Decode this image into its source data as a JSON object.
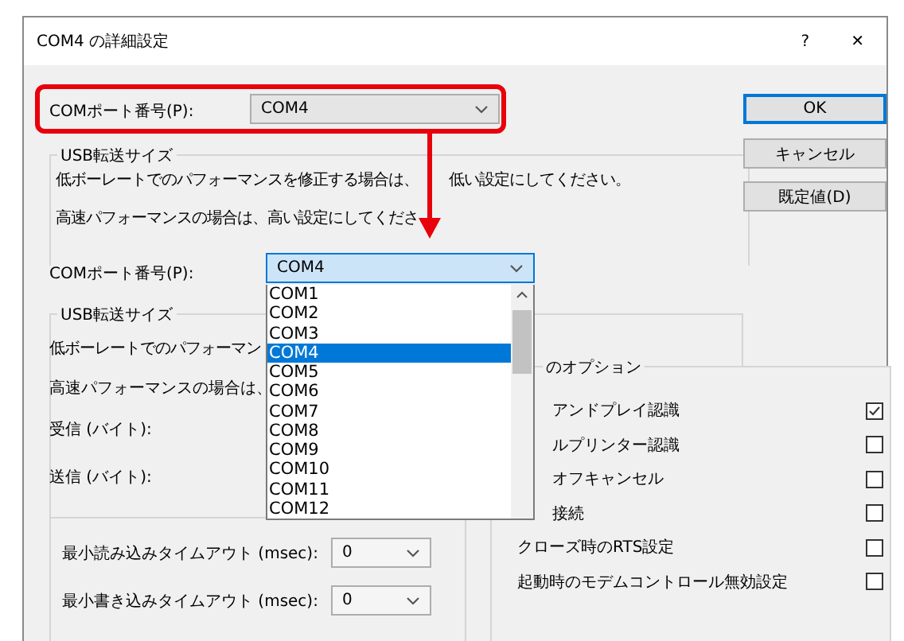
{
  "window": {
    "title": "COM4 の詳細設定",
    "help": "?",
    "close": "✕"
  },
  "top": {
    "port_label": "COMポート番号(P):",
    "port_value": "COM4",
    "group_title": "USB転送サイズ",
    "line_1": "低ボーレートでのパフォーマンスを修正する場合は、",
    "line_1_rest": "低い設定にしてください。",
    "line_2": "高速パフォーマンスの場合は、高い設定にしてくださ"
  },
  "buttons": [
    {
      "label": "OK",
      "default": true
    },
    {
      "label": "キャンセル",
      "default": false
    },
    {
      "label": "既定値(D)",
      "default": false
    }
  ],
  "port": {
    "label": "COMポート番号(P):",
    "value": "COM4",
    "items": [
      {
        "label": "COM1",
        "selected": false
      },
      {
        "label": "COM2",
        "selected": false
      },
      {
        "label": "COM3",
        "selected": false
      },
      {
        "label": "COM4",
        "selected": true
      },
      {
        "label": "COM5",
        "selected": false
      },
      {
        "label": "COM6",
        "selected": false
      },
      {
        "label": "COM7",
        "selected": false
      },
      {
        "label": "COM8",
        "selected": false
      },
      {
        "label": "COM9",
        "selected": false
      },
      {
        "label": "COM10",
        "selected": false
      },
      {
        "label": "COM11",
        "selected": false
      },
      {
        "label": "COM12",
        "selected": false
      }
    ]
  },
  "usb": {
    "title": "USB転送サイズ",
    "line_1": "低ボーレートでのパフォーマン",
    "line_2": "高速パフォーマンスの場合は、",
    "receive": "受信 (バイト):",
    "send": "送信 (バイト):"
  },
  "timeouts": [
    {
      "label": "最小読み込みタイムアウト (msec):",
      "value": "0"
    },
    {
      "label": "最小書き込みタイムアウト (msec):",
      "value": "0"
    }
  ],
  "options": {
    "title": "のオプション",
    "rows": [
      {
        "label": "アンドプレイ認識",
        "checked": true
      },
      {
        "label": "ルプリンター認識",
        "checked": false
      },
      {
        "label": "オフキャンセル",
        "checked": false
      },
      {
        "label": "接続",
        "checked": false
      },
      {
        "label": "クローズ時のRTS設定",
        "checked": false
      },
      {
        "label": "起動時のモデムコントロール無効設定",
        "checked": false
      }
    ]
  }
}
